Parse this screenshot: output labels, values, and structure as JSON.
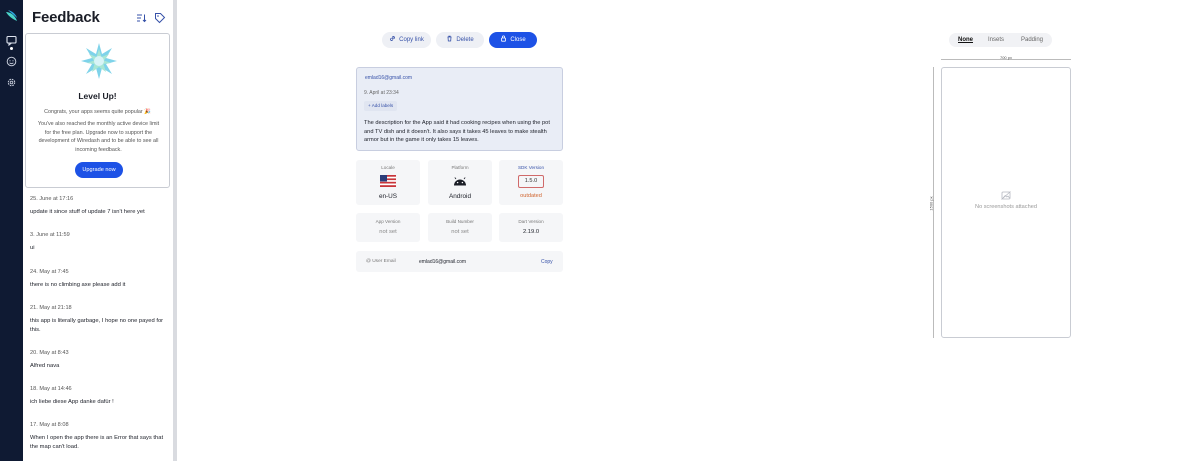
{
  "panel": {
    "title": "Feedback"
  },
  "upgrade": {
    "heading": "Level Up!",
    "line1": "Congrats, your apps seems quite popular 🎉",
    "line2": "You've also reached the monthly active device limit for the free plan. Upgrade now to support the development of Wiredash and to be able to see all incoming feedback.",
    "button": "Upgrade now"
  },
  "feedback_items": [
    {
      "date": "25. June at 17:16",
      "text": "update it since stuff of update 7 isn't here yet"
    },
    {
      "date": "3. June at 11:59",
      "text": "ui"
    },
    {
      "date": "24. May at 7:45",
      "text": "there is no climbing axe please add it"
    },
    {
      "date": "21. May at 21:18",
      "text": "this app is literally garbage, I hope no one payed for this."
    },
    {
      "date": "20. May at 8:43",
      "text": "Alfred nava"
    },
    {
      "date": "18. May at 14:46",
      "text": "ich liebe diese App danke dafür !"
    },
    {
      "date": "17. May at 8:08",
      "text": "When I open the app there is an Error that says that the map can't load."
    }
  ],
  "toolbar": {
    "copy_link": "Copy link",
    "delete": "Delete",
    "close": "Close"
  },
  "message": {
    "email": "emlad16@gmail.com",
    "time": "9. April at 23:34",
    "add_labels": "Add labels",
    "body": "The description for the App said it had cooking recipes when using the pot and TV dish and it doesn't. It also says it takes 45 leaves to make stealth armor but in the game it only takes 15 leaves."
  },
  "info": {
    "locale_label": "Locale",
    "locale_value": "en-US",
    "platform_label": "Platform",
    "platform_value": "Android",
    "sdk_label": "SDK Version",
    "sdk_value": "1.5.0",
    "sdk_status": "outdated",
    "app_version_label": "App Version",
    "app_version_value": "not set",
    "build_label": "Build Number",
    "build_value": "not set",
    "dart_label": "Dart Version",
    "dart_value": "2.19.0"
  },
  "user_email": {
    "label": "User Email",
    "value": "emlad16@gmail.com",
    "copy": "Copy"
  },
  "preview": {
    "tabs": [
      "None",
      "Insets",
      "Padding"
    ],
    "active_tab": "None",
    "width_label": "700 px",
    "height_label": "1500 px",
    "placeholder": "No screenshots attached"
  },
  "colors": {
    "rail": "#0f1a33",
    "accent": "#1d52e6",
    "outdated": "#d0642e"
  }
}
